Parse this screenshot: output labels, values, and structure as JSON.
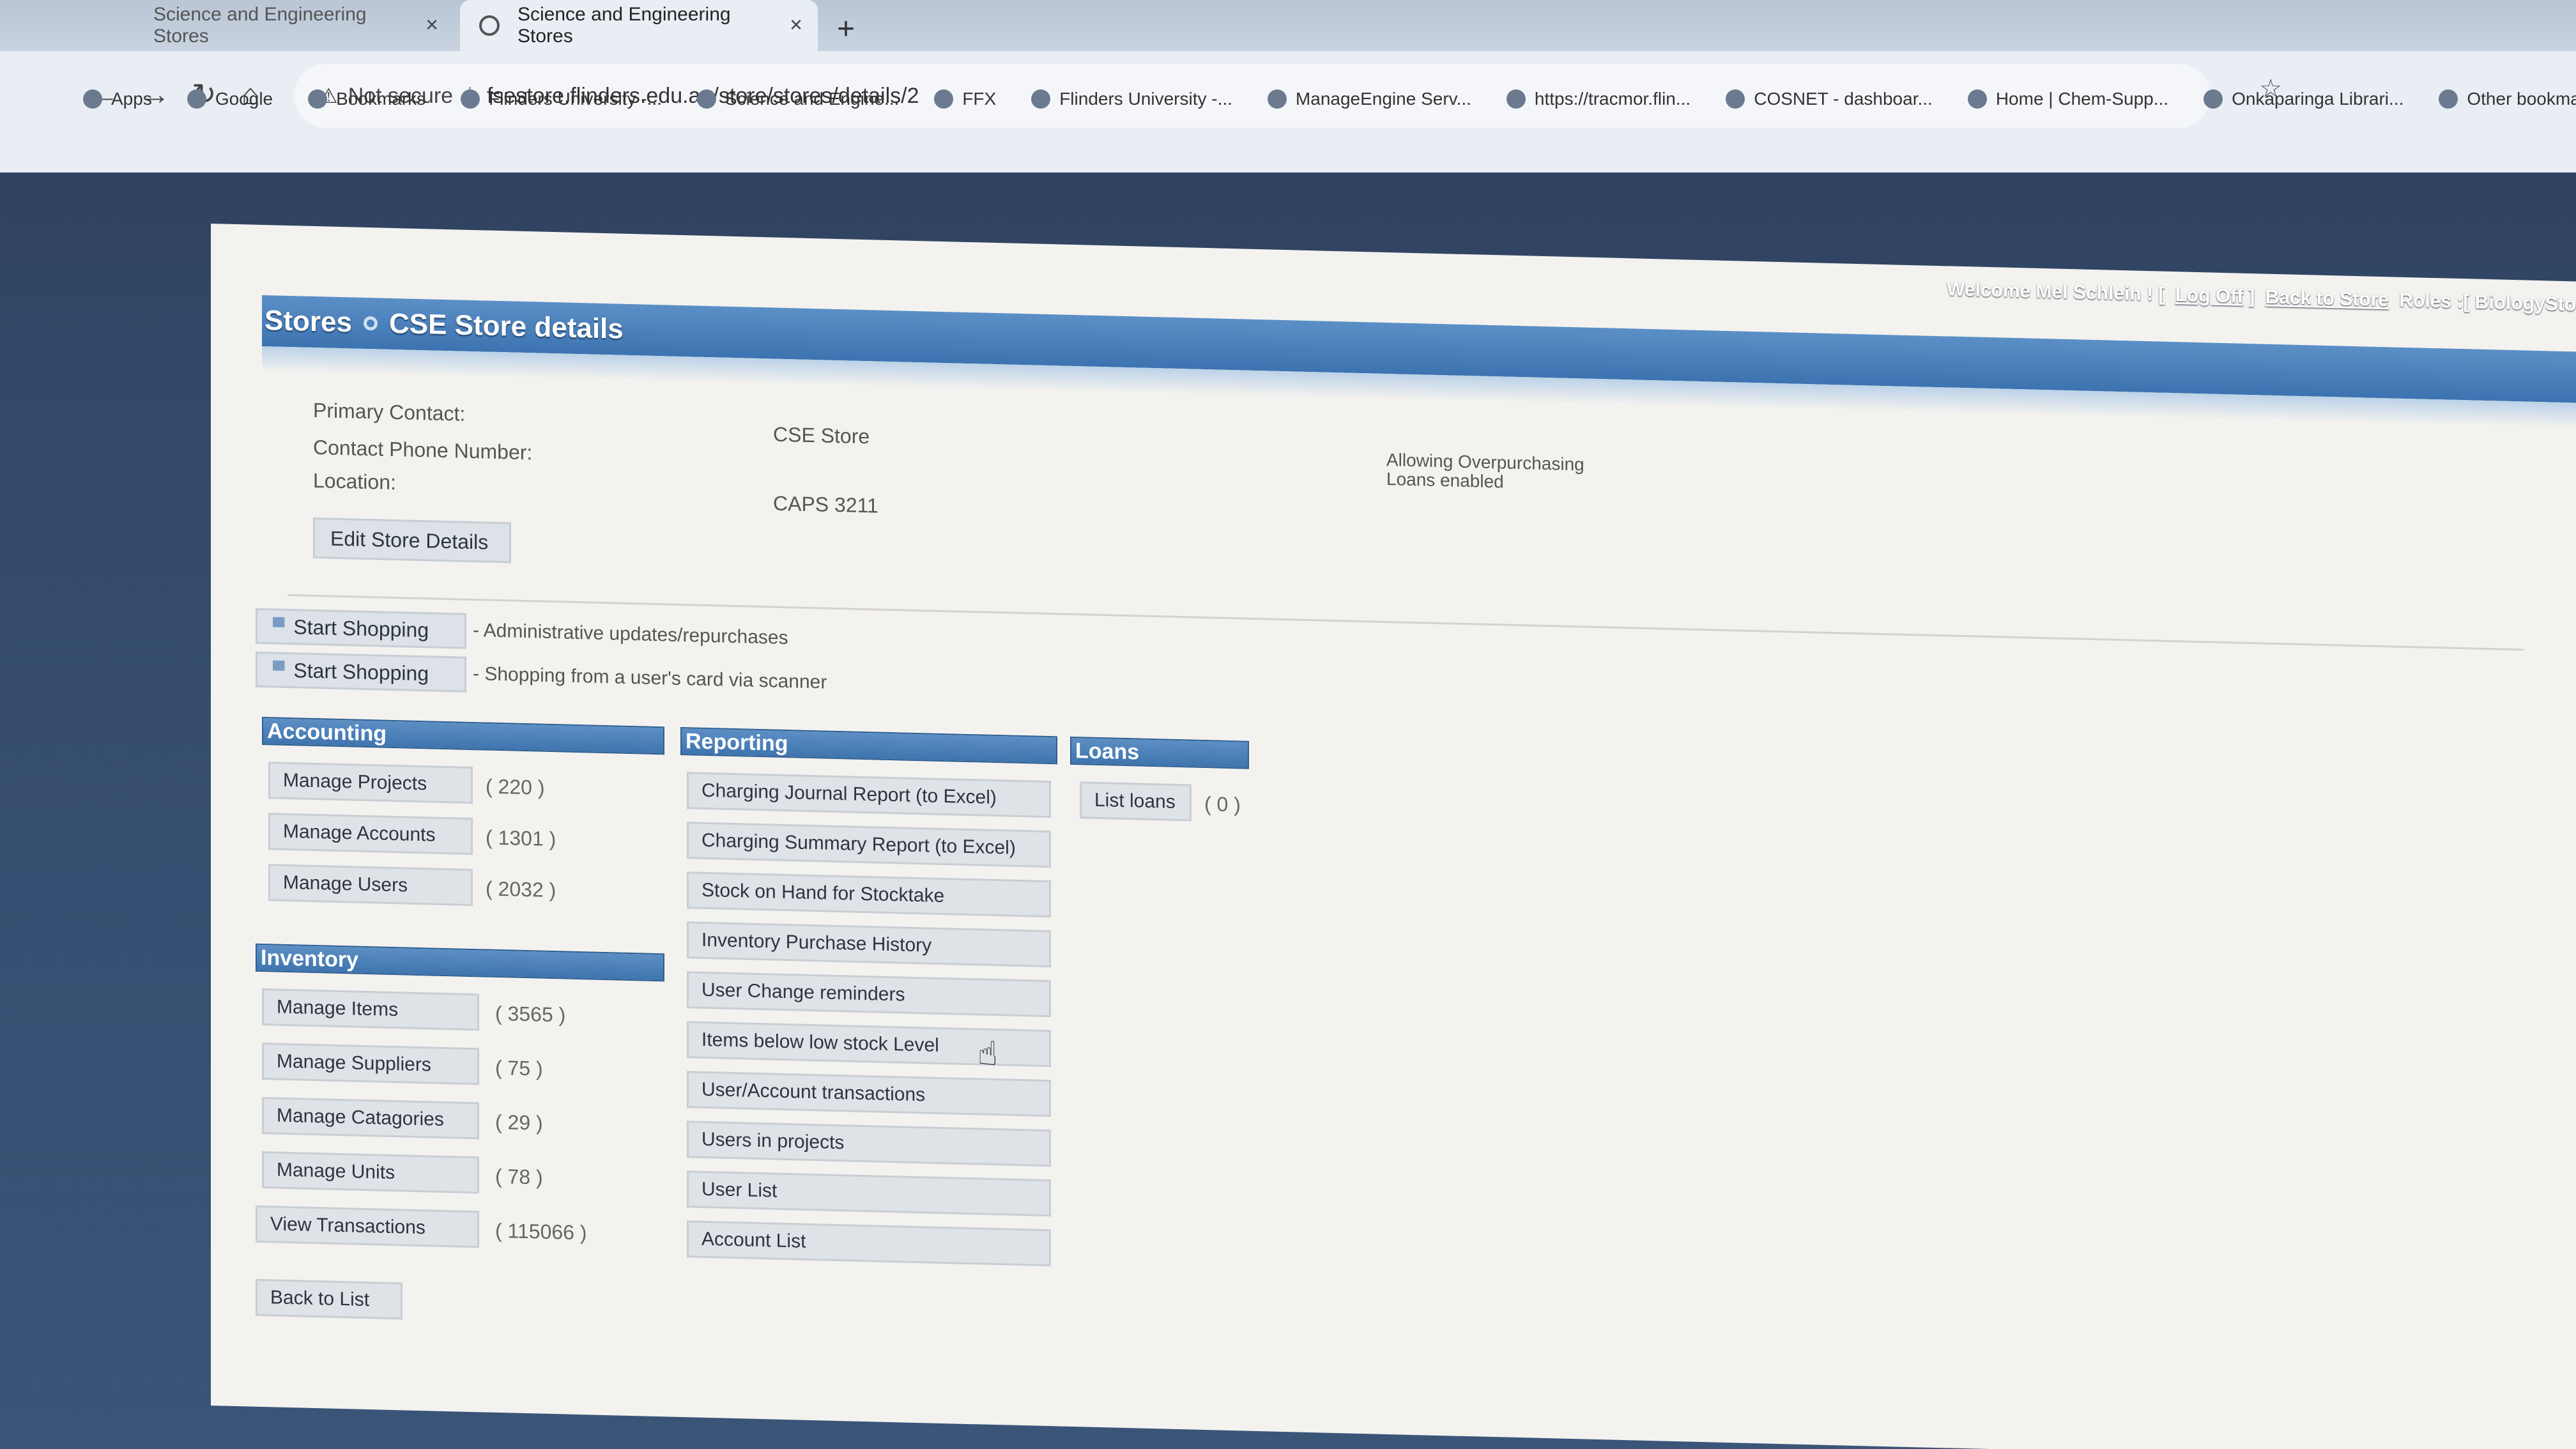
{
  "browser": {
    "tabs": [
      {
        "label": "Science and Engineering Stores",
        "active": false
      },
      {
        "label": "Science and Engineering Stores",
        "active": true
      }
    ],
    "security": "Not secure",
    "url": "fsestore.flinders.edu.au/store/stores/details/2",
    "bookmarks": [
      "Apps",
      "Google",
      "Bookmarks",
      "Flinders University -...",
      "Science and Engine...",
      "FFX",
      "Flinders University -...",
      "ManageEngine Serv...",
      "https://tracmor.flin...",
      "COSNET - dashboar...",
      "Home | Chem-Supp...",
      "Onkaparinga Librari..."
    ],
    "other_bookmarks": "Other bookmarks"
  },
  "userbar": {
    "welcome": "Welcome Mel Schlein ! [",
    "logoff": "Log Off",
    "close": "]",
    "back_to_store": "Back to Store",
    "roles": "Roles :[ BiologySto"
  },
  "header": {
    "crumb_root": "Stores",
    "crumb_current": "CSE Store details"
  },
  "details": {
    "primary_contact_label": "Primary Contact:",
    "phone_label": "Contact Phone Number:",
    "location_label": "Location:",
    "store_name": "CSE Store",
    "location_value": "CAPS 3211",
    "flag_overpurchasing": "Allowing Overpurchasing",
    "flag_loans": "Loans enabled",
    "edit_button": "Edit Store Details"
  },
  "shopping": [
    {
      "label": "Start Shopping",
      "note": "- Administrative updates/repurchases"
    },
    {
      "label": "Start Shopping",
      "note": "- Shopping from a user's card via scanner"
    }
  ],
  "accounting": {
    "title": "Accounting",
    "items": [
      {
        "label": "Manage Projects",
        "count": "( 220 )"
      },
      {
        "label": "Manage Accounts",
        "count": "( 1301 )"
      },
      {
        "label": "Manage Users",
        "count": "( 2032 )"
      }
    ]
  },
  "inventory": {
    "title": "Inventory",
    "items": [
      {
        "label": "Manage Items",
        "count": "( 3565 )"
      },
      {
        "label": "Manage Suppliers",
        "count": "( 75 )"
      },
      {
        "label": "Manage Catagories",
        "count": "( 29 )"
      },
      {
        "label": "Manage Units",
        "count": "( 78 )"
      },
      {
        "label": "View Transactions",
        "count": "( 115066 )"
      }
    ]
  },
  "reporting": {
    "title": "Reporting",
    "items": [
      "Charging Journal Report (to Excel)",
      "Charging Summary Report (to Excel)",
      "Stock on Hand for Stocktake",
      "Inventory Purchase History",
      "User Change reminders",
      "Items below low stock Level",
      "User/Account transactions",
      "Users in projects",
      "User List",
      "Account List"
    ]
  },
  "loans": {
    "title": "Loans",
    "button": "List loans",
    "count": "( 0 )"
  },
  "footer": {
    "back_button": "Back to List"
  }
}
